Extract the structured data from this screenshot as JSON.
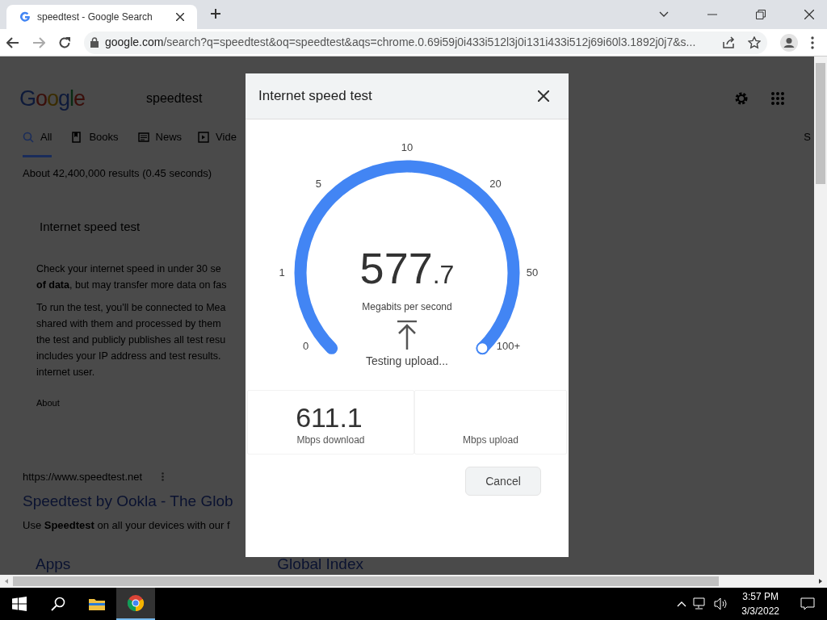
{
  "browser": {
    "tabs": [
      {
        "title": "speedtest - Google Search",
        "selected": true
      }
    ],
    "address": {
      "host": "google.com",
      "path": "/search?q=speedtest&oq=speedtest&aqs=chrome.0.69i59j0i433i512l3j0i131i433i512j69i60l3.1892j0j7&s..."
    }
  },
  "page": {
    "logo": "Google",
    "query": "speedtest",
    "tabs": [
      {
        "label": "All",
        "selected": true
      },
      {
        "label": "Books",
        "selected": false
      },
      {
        "label": "News",
        "selected": false
      },
      {
        "label": "Vide",
        "selected": false
      }
    ],
    "edge_text": "S",
    "result_stats": "About 42,400,000 results (0.45 seconds)",
    "widget_title": "Internet speed test",
    "paragraphs": [
      [
        "Check your internet speed in under 30 se",
        "**of data**, but may transfer more data on fas"
      ],
      [
        "To run the test, you'll be connected to Mea",
        "shared with them and processed by them",
        "the test and publicly publishes all test resu",
        "includes your IP address and test results.",
        "internet user."
      ]
    ],
    "about": "About",
    "result": {
      "url": "https://www.speedtest.net",
      "title": "Speedtest by Ookla - The Glob",
      "snippet": "Use **Speedtest** on all your devices with our f"
    },
    "sitelinks": [
      "Apps",
      "Global Index"
    ]
  },
  "dialog": {
    "title": "Internet speed test",
    "gauge": {
      "ticks": [
        "0",
        "1",
        "5",
        "10",
        "20",
        "50",
        "100+"
      ],
      "value": "577",
      "decimal": ".7",
      "unit": "Megabits per second",
      "status": "Testing upload..."
    },
    "results": [
      {
        "value": "611.1",
        "label": "Mbps download"
      },
      {
        "label": "Mbps upload"
      }
    ],
    "cancel": "Cancel"
  },
  "taskbar": {
    "apps": [
      {
        "kind": "start",
        "active": false
      },
      {
        "kind": "search",
        "active": false
      },
      {
        "kind": "explorer",
        "active": false
      },
      {
        "kind": "chrome",
        "active": true
      }
    ],
    "time": "3:57 PM",
    "date": "3/3/2022"
  }
}
